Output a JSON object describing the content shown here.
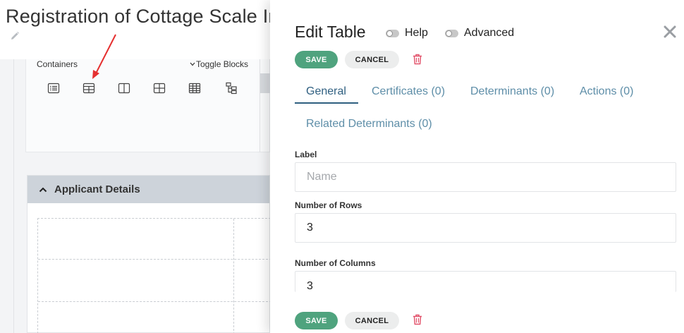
{
  "page": {
    "title": "Registration of Cottage Scale In",
    "palette": {
      "containers_label": "Containers",
      "toggle_blocks_label": "Toggle Blocks",
      "icons": [
        "list-icon",
        "table-icon",
        "columns-icon",
        "grid-icon",
        "table-large-icon",
        "tree-icon"
      ]
    },
    "section": {
      "header": "Applicant Details"
    }
  },
  "panel": {
    "title": "Edit Table",
    "help_label": "Help",
    "advanced_label": "Advanced",
    "save_label": "SAVE",
    "cancel_label": "CANCEL",
    "tabs": [
      {
        "label": "General",
        "active": true
      },
      {
        "label": "Certificates (0)",
        "active": false
      },
      {
        "label": "Determinants (0)",
        "active": false
      },
      {
        "label": "Actions (0)",
        "active": false
      },
      {
        "label": "Related Determinants (0)",
        "active": false
      }
    ],
    "fields": {
      "label": {
        "label": "Label",
        "value": "",
        "placeholder": "Name"
      },
      "rows": {
        "label": "Number of Rows",
        "value": "3"
      },
      "columns": {
        "label": "Number of Columns",
        "value": "3"
      }
    }
  },
  "colors": {
    "save": "#4fa37e",
    "tab_active": "#2f5f80",
    "tab_inactive": "#5e8ea8",
    "trash": "#e2516a",
    "arrow": "#e53030",
    "section_header": "#cdd3da"
  }
}
